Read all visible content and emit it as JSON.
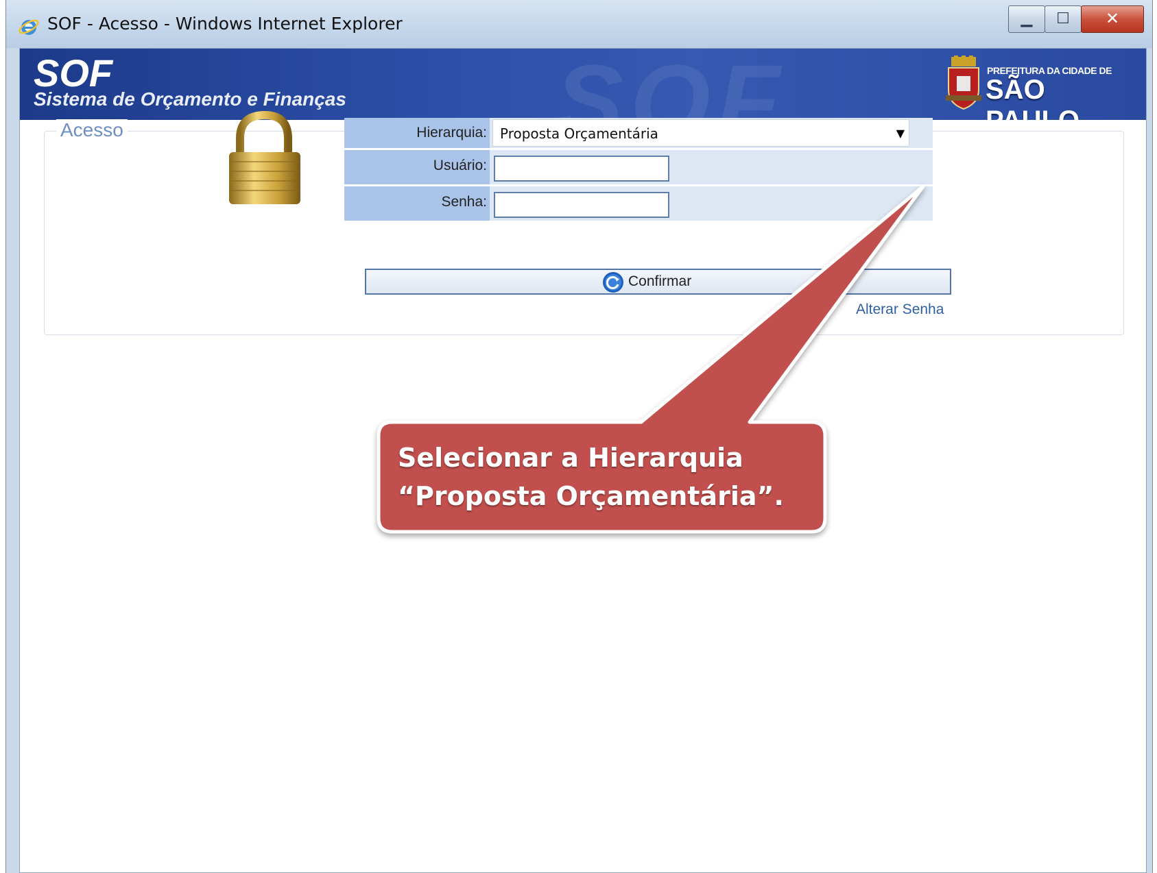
{
  "window": {
    "title": "SOF - Acesso - Windows Internet Explorer",
    "browser_icon": "internet-explorer-icon",
    "controls": [
      "minimize-icon",
      "maximize-icon",
      "close-icon"
    ]
  },
  "banner": {
    "logo": "SOF",
    "subtitle": "Sistema de Orçamento e Finanças",
    "city_top": "PREFEITURA DA CIDADE DE",
    "city_main": "SÃO PAULO"
  },
  "access": {
    "legend": "Acesso",
    "lock_icon": "padlock-icon",
    "fields": {
      "hierarquia_label": "Hierarquia:",
      "hierarquia_value": "Proposta Orçamentária",
      "usuario_label": "Usuário:",
      "usuario_value": "",
      "senha_label": "Senha:",
      "senha_value": ""
    },
    "confirm_label": "Confirmar",
    "change_password_link": "Alterar Senha"
  },
  "callout": {
    "line1": "Selecionar a Hierarquia",
    "line2": "“Proposta Orçamentária”.",
    "color": "#c0504d"
  }
}
